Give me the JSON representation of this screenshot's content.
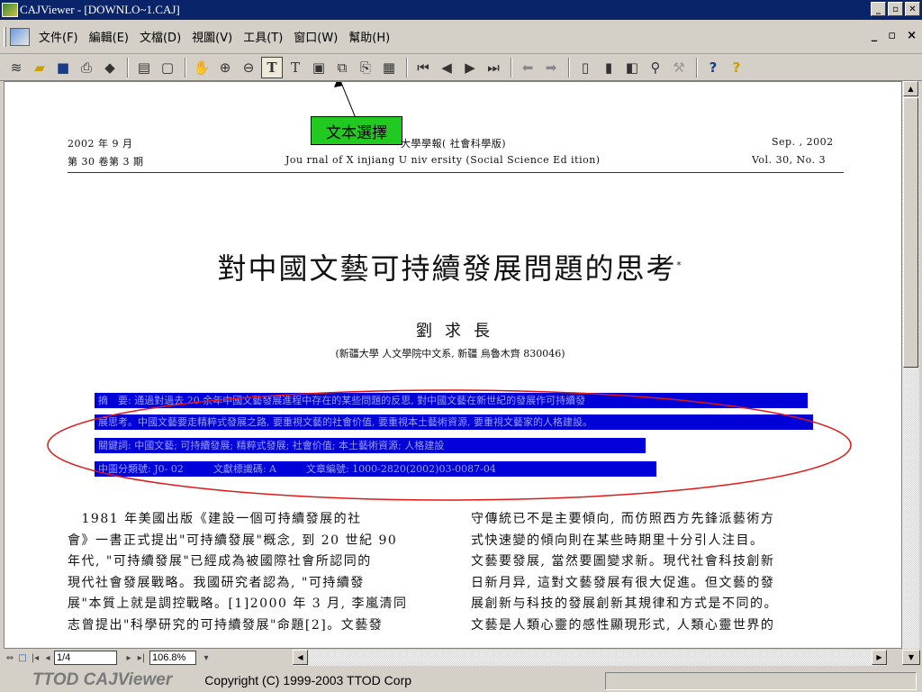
{
  "window": {
    "title": "CAJViewer - [DOWNLO~1.CAJ]",
    "buttons": [
      "_",
      "▫",
      "✕"
    ]
  },
  "menu": {
    "items": [
      "文件(F)",
      "編輯(E)",
      "文檔(D)",
      "視圖(V)",
      "工具(T)",
      "窗口(W)",
      "幫助(H)"
    ],
    "doc_controls": [
      "_",
      "▫",
      "×"
    ]
  },
  "toolbar": {
    "tooltip_balloon": "文本選擇"
  },
  "document": {
    "header_left_1": "2002 年 9 月",
    "header_left_2": "第 30 卷第 3 期",
    "header_center_1": "大學學報( 社會科學版)",
    "header_center_2": "Jou rnal of X injiang U niv ersity (Social Science Ed ition)",
    "header_right_1": "Sep. , 2002",
    "header_right_2": "Vol. 30, No. 3",
    "title": "對中國文藝可持續發展問題的思考",
    "title_mark": "*",
    "author": "劉求長",
    "affiliation": "(新疆大學 人文學院中文系, 新疆 烏魯木齊 830046)",
    "selected_lines": [
      "摘　要: 通過對過去 20 余年中國文藝發展進程中存在的某些問題的反思, 對中國文藝在新世紀的發展作可持續發",
      "展思考。中國文藝要走精粹式發展之路, 要重視文藝的社會价值, 要重視本土藝術資源, 要重視文藝家的人格建設。",
      "關鍵詞: 中國文藝; 可持續發展; 精粹式發展; 社會价值; 本土藝術資源; 人格建設",
      "中圖分類號: J0- 02　　　文獻標識碼: A　　　文章編號: 1000-2820(2002)03-0087-04"
    ],
    "col_left": [
      "　1981 年美國出版《建設一個可持續發展的社",
      "會》一書正式提出\"可持續發展\"概念, 到 20 世紀 90",
      "年代, \"可持續發展\"已經成為被國際社會所認同的",
      "現代社會發展戰略。我國研究者認為, \"可持續發",
      "展\"本質上就是調控戰略。[1]2000 年 3 月, 李嵐清同",
      "志曾提出\"科學研究的可持續發展\"命題[2]。文藝發"
    ],
    "col_right": [
      "守傳統已不是主要傾向, 而仿照西方先鋒派藝術方",
      "式快速變的傾向則在某些時期里十分引人注目。",
      "文藝要發展, 當然要圖變求新。現代社會科技創新",
      "日新月异, 這對文藝發展有很大促進。但文藝的發",
      "展創新与科技的發展創新其規律和方式是不同的。",
      "文藝是人類心靈的感性顯現形式, 人類心靈世界的"
    ]
  },
  "navigation": {
    "page": "1/4",
    "zoom": "106.8%"
  },
  "status": {
    "brand": "TTOD CAJViewer",
    "copyright": "Copyright (C) 1999-2003 TTOD Corp"
  }
}
